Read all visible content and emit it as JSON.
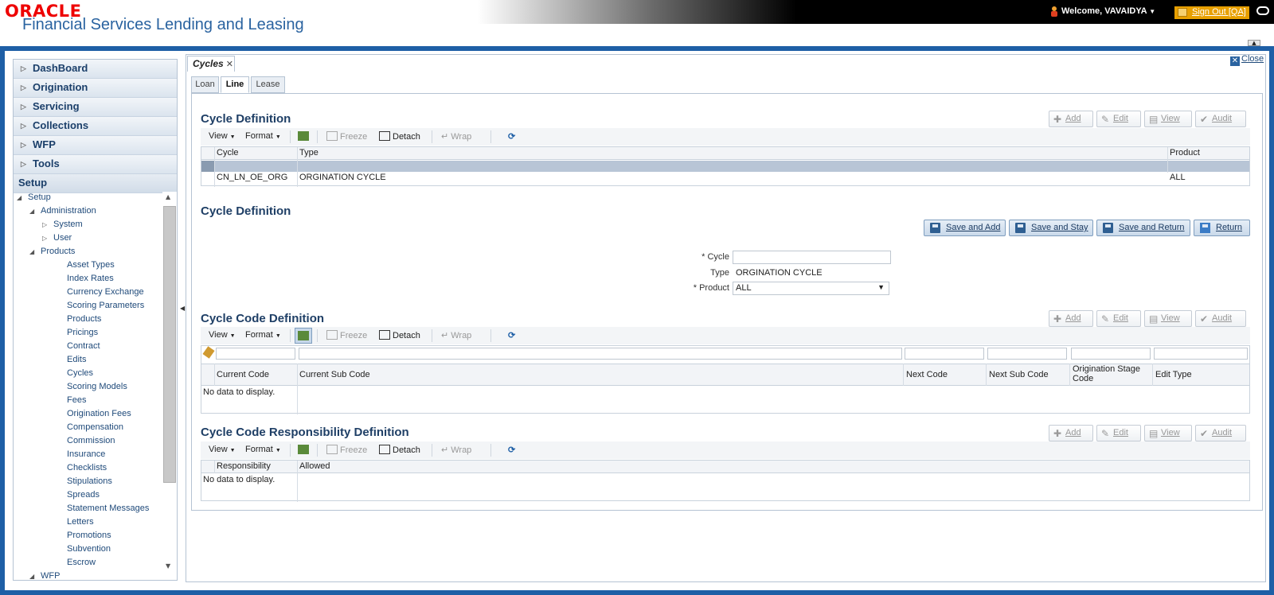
{
  "header": {
    "logo": "ORACLE",
    "product": "Financial Services Lending and Leasing",
    "welcome": "Welcome, VAVAIDYA",
    "signout": "Sign Out [QA]"
  },
  "nav": {
    "accordions": [
      {
        "label": "DashBoard"
      },
      {
        "label": "Origination"
      },
      {
        "label": "Servicing"
      },
      {
        "label": "Collections"
      },
      {
        "label": "WFP"
      },
      {
        "label": "Tools"
      }
    ],
    "setup_label": "Setup",
    "tree": {
      "root": "Setup",
      "administration": "Administration",
      "system": "System",
      "user": "User",
      "products": "Products",
      "product_items": [
        "Asset Types",
        "Index Rates",
        "Currency Exchange",
        "Scoring Parameters",
        "Products",
        "Pricings",
        "Contract",
        "Edits",
        "Cycles",
        "Scoring Models",
        "Fees",
        "Origination Fees",
        "Compensation",
        "Commission",
        "Insurance",
        "Checklists",
        "Stipulations",
        "Spreads",
        "Statement Messages",
        "Letters",
        "Promotions",
        "Subvention",
        "Escrow"
      ],
      "wfp": "WFP"
    }
  },
  "main": {
    "doc_tab": "Cycles",
    "close": "Close",
    "subtabs": [
      "Loan",
      "Line",
      "Lease"
    ],
    "active_subtab": "Line"
  },
  "actions": {
    "add": "Add",
    "edit": "Edit",
    "view": "View",
    "audit": "Audit"
  },
  "toolbar": {
    "view": "View",
    "format": "Format",
    "freeze": "Freeze",
    "detach": "Detach",
    "wrap": "Wrap"
  },
  "cycle_definition": {
    "title": "Cycle Definition",
    "columns": [
      "Cycle",
      "Type",
      "Product"
    ],
    "rows": [
      [
        "",
        "",
        ""
      ],
      [
        "CN_LN_OE_ORG",
        "ORGINATION CYCLE",
        "ALL"
      ]
    ]
  },
  "cycle_form": {
    "title": "Cycle Definition",
    "buttons": {
      "save_add": "Save and Add",
      "save_stay": "Save and Stay",
      "save_return": "Save and Return",
      "return": "Return"
    },
    "cycle_label": "Cycle",
    "cycle_value": "",
    "type_label": "Type",
    "type_value": "ORGINATION CYCLE",
    "product_label": "Product",
    "product_value": "ALL",
    "required_marker": "*"
  },
  "cycle_code": {
    "title": "Cycle Code Definition",
    "columns": [
      "Current Code",
      "Current Sub Code",
      "Next Code",
      "Next Sub Code",
      "Origination Stage Code",
      "Edit Type"
    ],
    "empty": "No data to display."
  },
  "responsibility": {
    "title": "Cycle Code Responsibility Definition",
    "columns": [
      "Responsibility",
      "Allowed"
    ],
    "empty": "No data to display."
  },
  "colors": {
    "frame": "#1e5fa6",
    "title": "#1f3f66",
    "selected_row": "#b8c5d6"
  }
}
